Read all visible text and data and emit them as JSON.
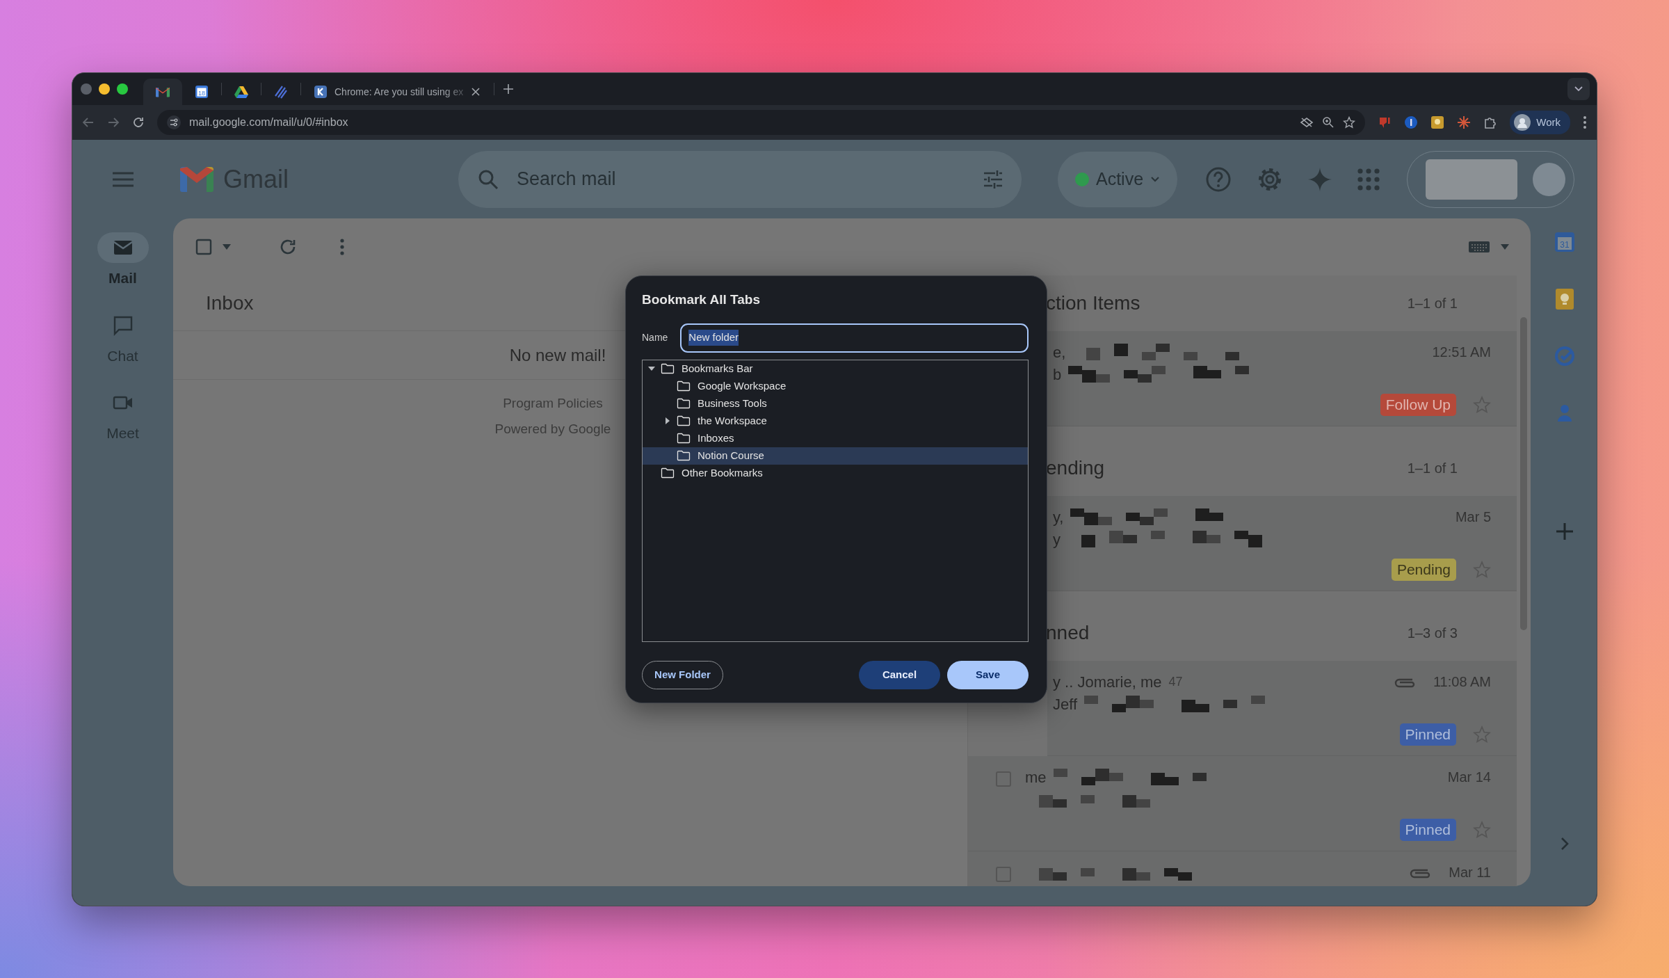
{
  "browser": {
    "tabs": [
      {
        "kind": "gmail",
        "selected": true
      },
      {
        "kind": "calendar",
        "icon_text": "18",
        "selected": false
      },
      {
        "kind": "drive",
        "selected": false
      },
      {
        "kind": "stripes",
        "selected": false
      },
      {
        "kind": "k",
        "title": "Chrome: Are you still using ex",
        "selected": false
      }
    ],
    "url": "mail.google.com/mail/u/0/#inbox",
    "profile": "Work"
  },
  "gmail": {
    "logo_text": "Gmail",
    "search_placeholder": "Search mail",
    "status": {
      "label": "Active",
      "color": "#2f9a4e"
    },
    "nav": [
      {
        "kind": "mail",
        "label": "Mail",
        "selected": true
      },
      {
        "kind": "chat",
        "label": "Chat",
        "selected": false
      },
      {
        "kind": "meet",
        "label": "Meet",
        "selected": false
      }
    ],
    "inbox": {
      "title": "Inbox",
      "empty": "No new mail!",
      "footer": [
        "Program Policies",
        "Powered by Google"
      ]
    },
    "sections": [
      {
        "title": "ction Items",
        "count": "1–1 of 1",
        "rows": [
          {
            "sender": "e,",
            "snippet": "b",
            "time": "12:51 AM",
            "attachment": false,
            "label": {
              "text": "Follow Up",
              "color": "#b5493a"
            },
            "starred": false
          }
        ]
      },
      {
        "title": "ending",
        "count": "1–1 of 1",
        "rows": [
          {
            "sender": "y,",
            "snippet": "y",
            "time": "Mar 5",
            "attachment": false,
            "label": {
              "text": "Pending",
              "color": "#a89d4c"
            },
            "starred": false
          }
        ]
      },
      {
        "title": "nned",
        "count": "1–3 of 3",
        "rows": [
          {
            "sender": "y .. Jomarie, me",
            "thread_count": "47",
            "snippet": "Jeff",
            "time": "11:08 AM",
            "attachment": true,
            "label": {
              "text": "Pinned",
              "color": "#3d5ea6"
            },
            "starred": false
          },
          {
            "selected": false,
            "sender": "me",
            "time": "Mar 14",
            "attachment": false,
            "label": {
              "text": "Pinned",
              "color": "#3d5ea6"
            },
            "starred": false
          },
          {
            "selected": false,
            "time": "Mar 11",
            "attachment": true
          }
        ]
      }
    ],
    "side_apps": [
      {
        "kind": "calendar",
        "icon_text": "31"
      },
      {
        "kind": "keep"
      },
      {
        "kind": "tasks"
      },
      {
        "kind": "contacts"
      }
    ]
  },
  "dialog": {
    "title": "Bookmark All Tabs",
    "name_label": "Name",
    "name_value": "New folder",
    "value_selected": true,
    "tree": [
      {
        "label": "Bookmarks Bar",
        "expanded": true,
        "selected": false,
        "children": [
          {
            "label": "Google Workspace",
            "selected": false
          },
          {
            "label": "Business Tools",
            "selected": false
          },
          {
            "label": "the Workspace",
            "expanded": false,
            "selected": false
          },
          {
            "label": "Inboxes",
            "selected": false
          },
          {
            "label": "Notion Course",
            "selected": true
          }
        ]
      },
      {
        "label": "Other Bookmarks",
        "selected": false
      }
    ],
    "buttons": [
      {
        "kind": "outline",
        "label": "New Folder"
      },
      {
        "kind": "secondary",
        "label": "Cancel"
      },
      {
        "kind": "primary",
        "label": "Save"
      }
    ]
  }
}
